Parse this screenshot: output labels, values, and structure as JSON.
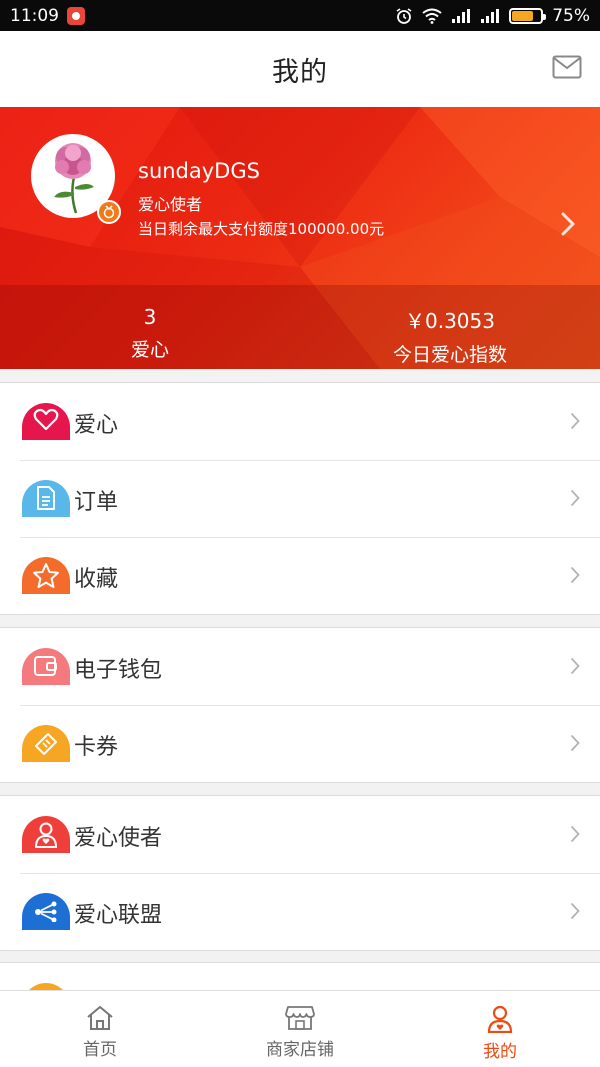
{
  "status_bar": {
    "time": "11:09",
    "battery": "75%",
    "battery_level": 0.75,
    "icons": [
      "app-notification-icon",
      "alarm-icon",
      "wifi-icon",
      "signal-icon",
      "signal-icon",
      "battery-icon"
    ]
  },
  "header": {
    "title": "我的",
    "mail_icon": "mail-icon"
  },
  "profile": {
    "username": "sundayDGS",
    "role": "爱心使者",
    "quota": "当日剩余最大支付额度100000.00元",
    "stats": [
      {
        "value": "3",
        "label": "爱心"
      },
      {
        "value": "￥0.3053",
        "label": "今日爱心指数"
      }
    ]
  },
  "menu_groups": [
    [
      {
        "label": "爱心",
        "icon": "heart-icon",
        "color": "#e6164d"
      },
      {
        "label": "订单",
        "icon": "document-icon",
        "color": "#5ab7ea"
      },
      {
        "label": "收藏",
        "icon": "star-icon",
        "color": "#f36c2b"
      }
    ],
    [
      {
        "label": "电子钱包",
        "icon": "wallet-icon",
        "color": "#f47a7e"
      },
      {
        "label": "卡券",
        "icon": "coupon-icon",
        "color": "#f6a623"
      }
    ],
    [
      {
        "label": "爱心使者",
        "icon": "ambassador-icon",
        "color": "#ef3f3b"
      },
      {
        "label": "爱心联盟",
        "icon": "share-network-icon",
        "color": "#1d6fd4"
      }
    ]
  ],
  "tabbar": {
    "tabs": [
      {
        "label": "首页",
        "icon": "home-icon",
        "active": false
      },
      {
        "label": "商家店铺",
        "icon": "store-icon",
        "active": false
      },
      {
        "label": "我的",
        "icon": "user-icon",
        "active": true
      }
    ],
    "active_color": "#ee4a12"
  }
}
